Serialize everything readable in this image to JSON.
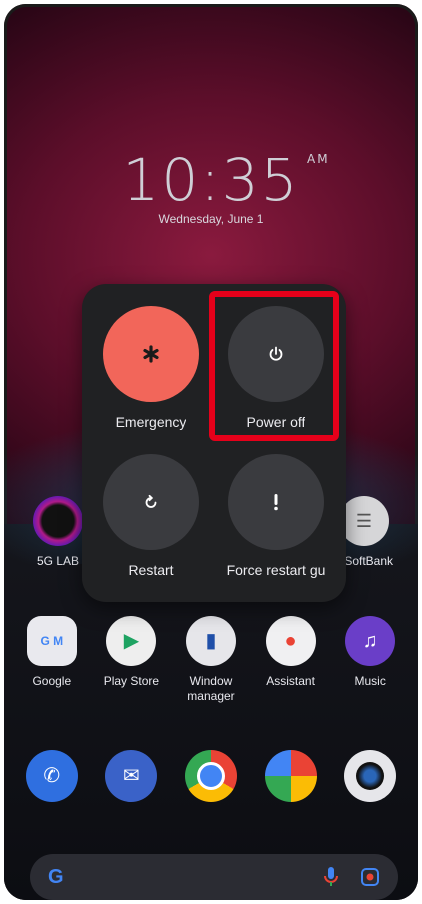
{
  "clock": {
    "time": "10:35",
    "ampm": "AM",
    "date": "Wednesday, June 1"
  },
  "power_menu": {
    "emergency_label": "Emergency",
    "power_off_label": "Power off",
    "restart_label": "Restart",
    "force_restart_label": "Force restart gu"
  },
  "home_row1": [
    {
      "label": "5G LAB",
      "icon": "5g-lab-icon"
    },
    {
      "label": "y SoftBank",
      "icon": "my-softbank-icon"
    }
  ],
  "home_row2": [
    {
      "label": "Google",
      "icon": "google-folder-icon"
    },
    {
      "label": "Play Store",
      "icon": "play-store-icon"
    },
    {
      "label": "Window manager",
      "icon": "window-manager-icon"
    },
    {
      "label": "Assistant",
      "icon": "assistant-icon"
    },
    {
      "label": "Music",
      "icon": "music-icon"
    }
  ],
  "dock": [
    {
      "icon": "phone-icon"
    },
    {
      "icon": "messages-icon"
    },
    {
      "icon": "chrome-icon"
    },
    {
      "icon": "photos-icon"
    },
    {
      "icon": "camera-icon"
    }
  ],
  "search": {
    "logo": "G"
  },
  "colors": {
    "emergency": "#f2665a",
    "highlight": "#e6001a",
    "panel": "#202123"
  }
}
